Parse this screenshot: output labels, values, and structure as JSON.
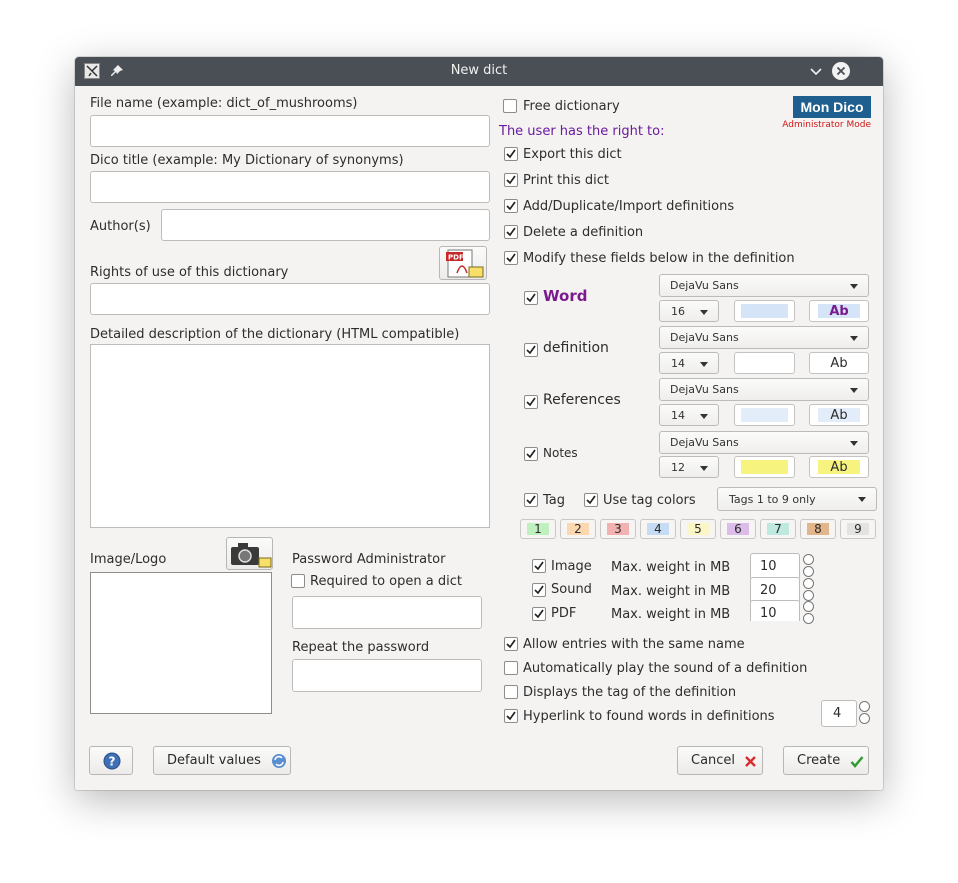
{
  "window": {
    "title": "New dict"
  },
  "left": {
    "file_name_label": "File name (example: dict_of_mushrooms)",
    "file_name_value": "",
    "dico_title_label": "Dico title (example: My Dictionary of synonyms)",
    "dico_title_value": "",
    "authors_label": "Author(s)",
    "authors_value": "",
    "rights_label": "Rights of use of this dictionary",
    "rights_value": "",
    "description_label": "Detailed description of the dictionary (HTML compatible)",
    "description_value": "",
    "image_logo_label": "Image/Logo",
    "password_label": "Password Administrator",
    "required_label": "Required to open a dict",
    "repeat_label": "Repeat the password"
  },
  "right": {
    "free_dictionary": "Free dictionary",
    "logo_text": "Mon Dico",
    "logo_mode": "Administrator Mode",
    "user_right_heading": "The user has the right to:",
    "rights": [
      {
        "label": "Export this dict",
        "checked": true
      },
      {
        "label": "Print this dict",
        "checked": true
      },
      {
        "label": "Add/Duplicate/Import definitions",
        "checked": true
      },
      {
        "label": "Delete a definition",
        "checked": true
      },
      {
        "label": "Modify these fields below in the definition",
        "checked": true
      }
    ],
    "fields": [
      {
        "label": "Word",
        "font": "DejaVu Sans",
        "size": "16",
        "bg": "#d6e4f7",
        "sample": "Ab",
        "sample_color": "#7a1a8e",
        "sample_bg": "#d6e4f7"
      },
      {
        "label": "definition",
        "font": "DejaVu Sans",
        "size": "14",
        "bg": "#ffffff",
        "sample": "Ab",
        "sample_color": "#222222",
        "sample_bg": "#ffffff"
      },
      {
        "label": "References",
        "font": "DejaVu Sans",
        "size": "14",
        "bg": "#e3ecf9",
        "sample": "Ab",
        "sample_color": "#222222",
        "sample_bg": "#e3ecf9"
      },
      {
        "label": "Notes",
        "font": "DejaVu Sans",
        "size": "12",
        "bg": "#f6f47e",
        "sample": "Ab",
        "sample_color": "#222222",
        "sample_bg": "#f6f47e"
      }
    ],
    "tag_label": "Tag",
    "use_tag_colors_label": "Use tag colors",
    "tags_combo": "Tags 1 to 9 only",
    "tags": [
      {
        "n": "1",
        "color": "#bff0bf"
      },
      {
        "n": "2",
        "color": "#fbd8b0"
      },
      {
        "n": "3",
        "color": "#f2b2b2"
      },
      {
        "n": "4",
        "color": "#c5dcf4"
      },
      {
        "n": "5",
        "color": "#fbf6c6"
      },
      {
        "n": "6",
        "color": "#dcbde9"
      },
      {
        "n": "7",
        "color": "#bde9df"
      },
      {
        "n": "8",
        "color": "#e2b68a"
      },
      {
        "n": "9",
        "color": "#e3e3e1"
      }
    ],
    "media": [
      {
        "label": "Image",
        "weight_label": "Max. weight in MB",
        "value": "10"
      },
      {
        "label": "Sound",
        "weight_label": "Max. weight in MB",
        "value": "20"
      },
      {
        "label": "PDF",
        "weight_label": "Max. weight in MB",
        "value": "10"
      }
    ],
    "options": [
      {
        "label": "Allow entries with the same name",
        "checked": true
      },
      {
        "label": "Automatically play the sound of a definition",
        "checked": false
      },
      {
        "label": "Displays the tag of the definition",
        "checked": false
      },
      {
        "label": "Hyperlink to found words in definitions",
        "checked": true
      }
    ],
    "hyperlink_value": "4"
  },
  "footer": {
    "default_values": "Default values",
    "cancel": "Cancel",
    "create": "Create"
  },
  "colors": {
    "titlebar": "#4a4f55",
    "purple": "#6a1a9e",
    "accent_red": "#d92b2b",
    "accent_green": "#2e9a2e"
  }
}
